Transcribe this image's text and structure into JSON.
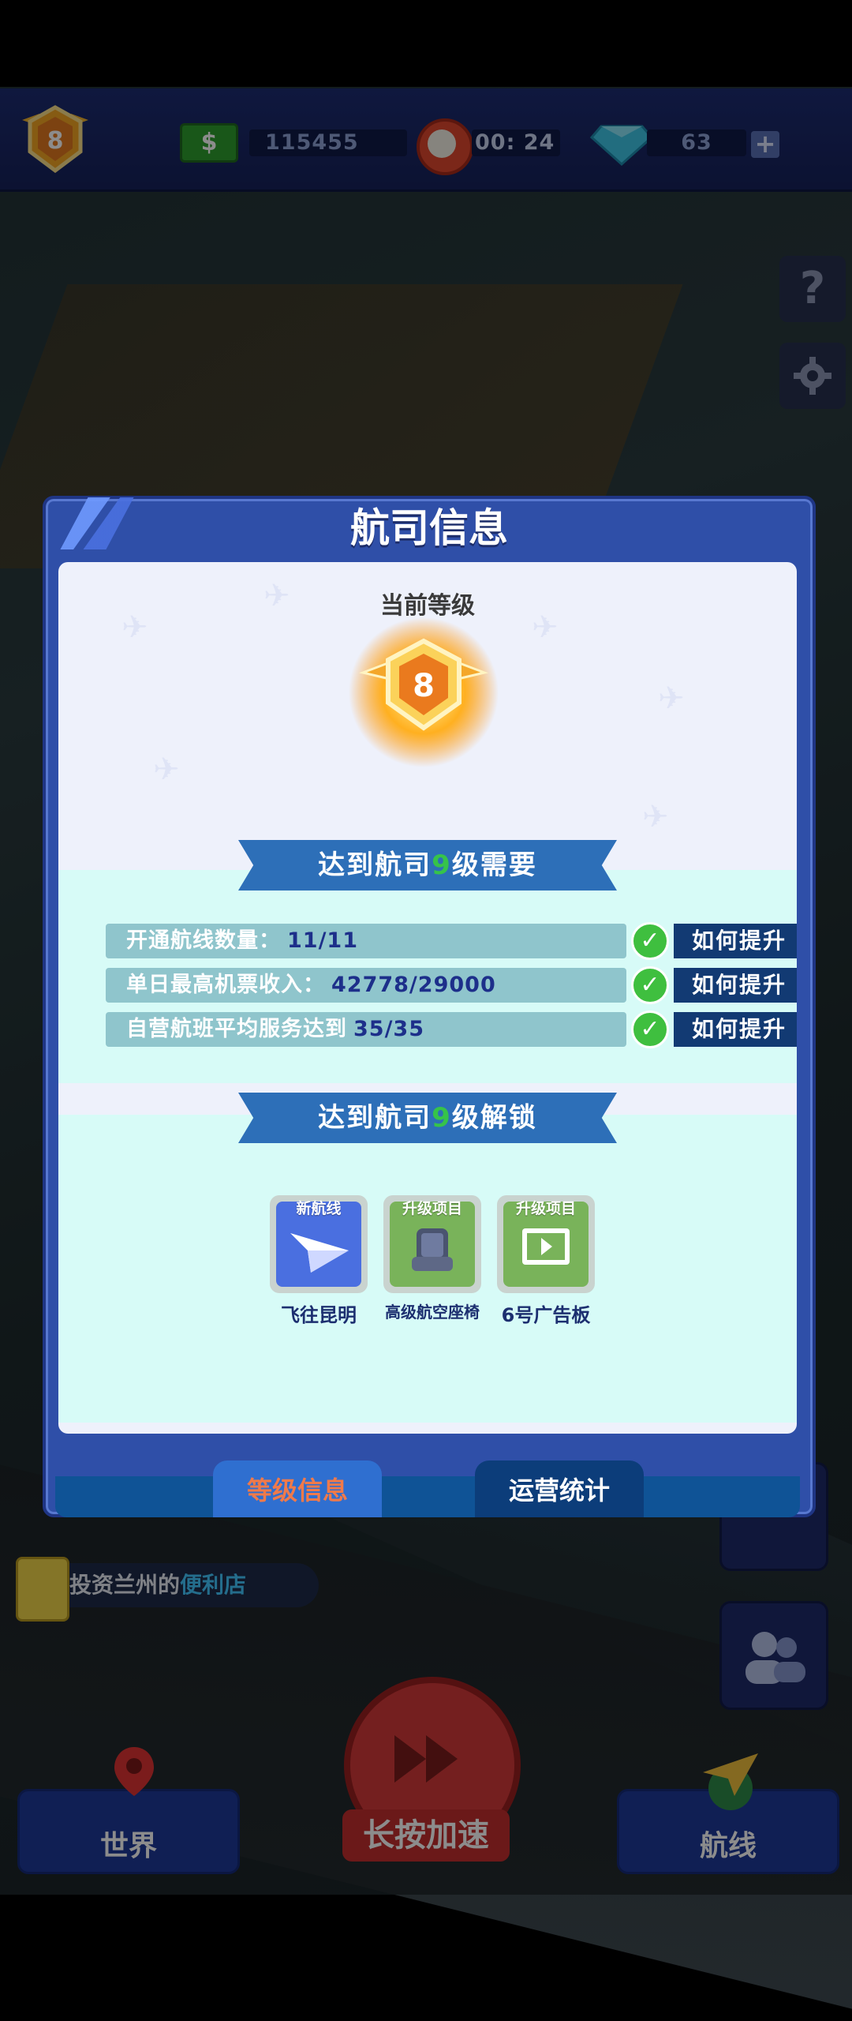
{
  "hud": {
    "level": "8",
    "money": "115455",
    "timer": "00: 24",
    "diamonds": "63",
    "money_icon": "money-icon",
    "timer_icon": "alarm-clock-icon",
    "diamond_icon": "diamond-icon"
  },
  "side_buttons": {
    "help": "?",
    "settings_icon": "gear-icon"
  },
  "modal": {
    "title": "航司信息",
    "current_level_label": "当前等级",
    "current_level": "8",
    "requirements_banner": {
      "prefix": "达到航司",
      "level": "9",
      "suffix": "级需要"
    },
    "requirements": [
      {
        "label": "开通航线数量：",
        "value": "11/11",
        "button": "如何提升"
      },
      {
        "label": "单日最高机票收入：",
        "value": "42778/29000",
        "button": "如何提升"
      },
      {
        "label": "自营航班平均服务达到",
        "value": "35/35",
        "button": "如何提升"
      }
    ],
    "unlock_banner": {
      "prefix": "达到航司",
      "level": "9",
      "suffix": "级解锁"
    },
    "unlocks": [
      {
        "tag": "新航线",
        "label": "飞往昆明",
        "icon": "paper-plane-icon",
        "color": "#4a6fe0"
      },
      {
        "tag": "升级项目",
        "label": "高级航空座椅",
        "icon": "airplane-seat-icon",
        "color": "#79b35a"
      },
      {
        "tag": "升级项目",
        "label": "6号广告板",
        "icon": "video-billboard-icon",
        "color": "#79b35a"
      }
    ],
    "tabs": [
      {
        "label": "等级信息",
        "active": true
      },
      {
        "label": "运营统计",
        "active": false
      }
    ]
  },
  "task": {
    "prefix": "投资兰州的",
    "highlight": "便利店"
  },
  "bottom": {
    "world": "世界",
    "speed": "长按加速",
    "routes": "航线"
  },
  "colors": {
    "hud_bg": "#1d2c72",
    "modal_border": "#2f4fa8",
    "banner": "#2d6fb8",
    "check_green": "#3fbf3f",
    "how_btn": "#123a73",
    "tab_active_text": "#f07a4a",
    "speed_red": "#d33a3a"
  }
}
